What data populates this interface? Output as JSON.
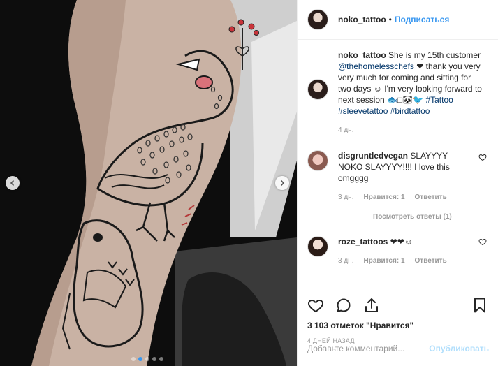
{
  "header": {
    "username": "noko_tattoo",
    "separator": "•",
    "follow_label": "Подписаться"
  },
  "caption": {
    "username": "noko_tattoo",
    "text_1": " She is my 15th customer ",
    "mention": "@thehomelesschefs",
    "text_2": " ❤ thank you very very much for coming and sitting for two days ☺ I'm very looking forward to next session 🐟□🐼🐦 ",
    "tag_1": "#Tattoo",
    "tag_2": "#sleevetattoo",
    "tag_3": "#birdtattoo",
    "time": "4 дн."
  },
  "comments": [
    {
      "username": "disgruntledvegan",
      "text": " SLAYYYY NOKO SLAYYYY!!!! I love this omgggg",
      "time": "3 дн.",
      "likes": "Нравится: 1",
      "reply": "Ответить"
    },
    {
      "username": "roze_tattoos",
      "text": " ❤❤☺",
      "time": "3 дн.",
      "likes": "Нравится: 1",
      "reply": "Ответить"
    }
  ],
  "view_replies": "Посмотреть ответы (1)",
  "actions": {
    "like_count": "3 103 отметок \"Нравится\"",
    "post_time": "4 дней назад"
  },
  "add_comment": {
    "placeholder": "Добавьте комментарий...",
    "publish_label": "Опубликовать"
  },
  "carousel": {
    "total_dots": 5,
    "active_index": 1
  },
  "colors": {
    "accent": "#3897f0",
    "publish_disabled": "#b2dffc",
    "meta_gray": "#999999",
    "link_dark": "#003569"
  }
}
